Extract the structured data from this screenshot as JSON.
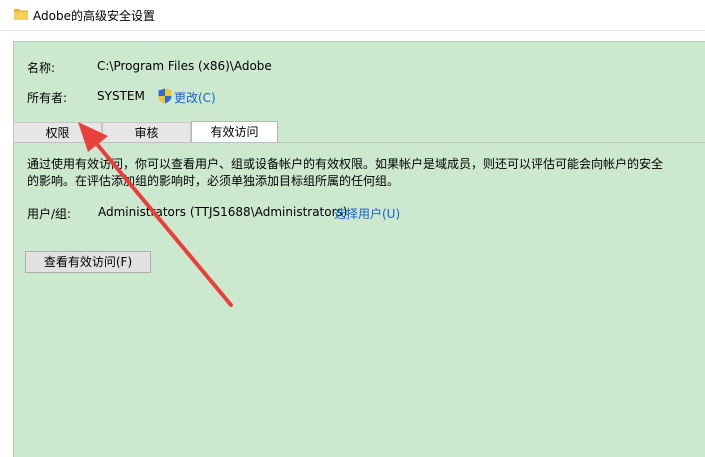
{
  "window": {
    "title": "Adobe的高级安全设置",
    "folder_icon": "folder-icon"
  },
  "props": {
    "name_label": "名称:",
    "name_value": "C:\\Program Files (x86)\\Adobe",
    "owner_label": "所有者:",
    "owner_value": "SYSTEM",
    "change_link": "更改(C)",
    "shield_icon": "uac-shield-icon"
  },
  "tabs": [
    {
      "label": "权限"
    },
    {
      "label": "审核"
    },
    {
      "label": "有效访问",
      "active": true
    }
  ],
  "description": [
    "通过使用有效访问，你可以查看用户、组或设备帐户的有效权限。如果帐户是域成员，则还可以评估可能会向帐户的安全",
    "的影响。在评估添加组的影响时，必须单独添加目标组所属的任何组。"
  ],
  "user_group": {
    "label": "用户/组:",
    "value": "Administrators (TTJS1688\\Administrators)",
    "select_link": "选择用户(U)"
  },
  "view_button": "查看有效访问(F)",
  "colors": {
    "panel_bg": "#cce8cf",
    "link": "#1a64c8",
    "annotation_arrow": "#e8413c"
  }
}
